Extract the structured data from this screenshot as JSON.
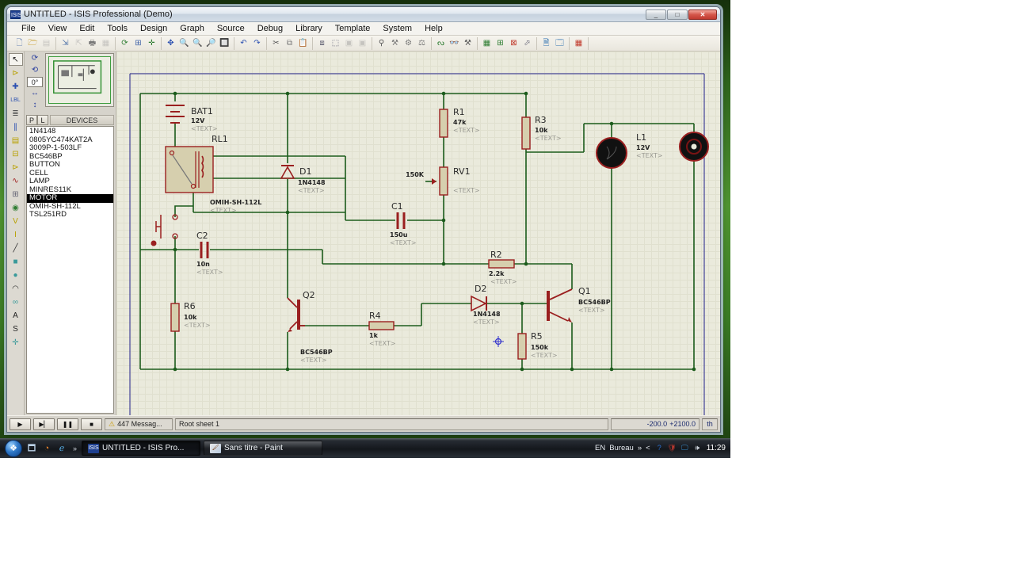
{
  "window": {
    "title": "UNTITLED - ISIS Professional (Demo)",
    "app_icon": "ISIS",
    "controls": {
      "minimize": "_",
      "maximize": "□",
      "close": "✕"
    }
  },
  "menu": {
    "items": [
      "File",
      "View",
      "Edit",
      "Tools",
      "Design",
      "Graph",
      "Source",
      "Debug",
      "Library",
      "Template",
      "System",
      "Help"
    ]
  },
  "toolbar": {
    "groups": [
      [
        {
          "name": "new-file-icon",
          "glyph": "🗋",
          "color": "#6a85b5"
        },
        {
          "name": "open-file-icon",
          "glyph": "🗁",
          "color": "#c9a23a"
        },
        {
          "name": "save-file-icon",
          "glyph": "▤",
          "color": "#888",
          "dim": true
        }
      ],
      [
        {
          "name": "import-icon",
          "glyph": "⇲",
          "color": "#5577aa"
        },
        {
          "name": "export-icon",
          "glyph": "⇱",
          "color": "#888",
          "dim": true
        },
        {
          "name": "print-icon",
          "glyph": "🖶",
          "color": "#777"
        },
        {
          "name": "mark-area-icon",
          "glyph": "▦",
          "color": "#888",
          "dim": true
        }
      ],
      [
        {
          "name": "redraw-icon",
          "glyph": "⟳",
          "color": "#2e7d32"
        },
        {
          "name": "grid-icon",
          "glyph": "⊞",
          "color": "#4466aa"
        },
        {
          "name": "origin-icon",
          "glyph": "✛",
          "color": "#2e7d32"
        }
      ],
      [
        {
          "name": "pan-icon",
          "glyph": "✥",
          "color": "#2a4fb0"
        },
        {
          "name": "zoom-in-icon",
          "glyph": "🔍",
          "color": "#555"
        },
        {
          "name": "zoom-out-icon",
          "glyph": "🔍",
          "color": "#555"
        },
        {
          "name": "zoom-all-icon",
          "glyph": "🔎",
          "color": "#555"
        },
        {
          "name": "zoom-area-icon",
          "glyph": "🔲",
          "color": "#555"
        }
      ],
      [
        {
          "name": "undo-icon",
          "glyph": "↶",
          "color": "#2a4fb0"
        },
        {
          "name": "redo-icon",
          "glyph": "↷",
          "color": "#2a4fb0"
        }
      ],
      [
        {
          "name": "cut-icon",
          "glyph": "✂",
          "color": "#555"
        },
        {
          "name": "copy-icon",
          "glyph": "⧉",
          "color": "#777"
        },
        {
          "name": "paste-icon",
          "glyph": "📋",
          "color": "#777"
        }
      ],
      [
        {
          "name": "block-copy-icon",
          "glyph": "⧈",
          "color": "#667"
        },
        {
          "name": "block-move-icon",
          "glyph": "⬚",
          "color": "#667"
        },
        {
          "name": "block-rotate-icon",
          "glyph": "▣",
          "color": "#888",
          "dim": true
        },
        {
          "name": "block-delete-icon",
          "glyph": "▣",
          "color": "#888",
          "dim": true
        }
      ],
      [
        {
          "name": "pick-device-icon",
          "glyph": "⚲",
          "color": "#555"
        },
        {
          "name": "make-device-icon",
          "glyph": "⚒",
          "color": "#777"
        },
        {
          "name": "packaging-icon",
          "glyph": "⚙",
          "color": "#777"
        },
        {
          "name": "decompose-icon",
          "glyph": "⚖",
          "color": "#777"
        }
      ],
      [
        {
          "name": "wire-autorouter-icon",
          "glyph": "ᔓ",
          "color": "#2e7d32"
        },
        {
          "name": "search-tag-icon",
          "glyph": "👓",
          "color": "#555"
        },
        {
          "name": "property-assign-icon",
          "glyph": "⚒",
          "color": "#555"
        }
      ],
      [
        {
          "name": "design-explorer-icon",
          "glyph": "▦",
          "color": "#2e7d32"
        },
        {
          "name": "new-sheet-icon",
          "glyph": "⊞",
          "color": "#2e7d32"
        },
        {
          "name": "remove-sheet-icon",
          "glyph": "⊠",
          "color": "#c0392b"
        },
        {
          "name": "goto-sheet-icon",
          "glyph": "⬀",
          "color": "#667"
        }
      ],
      [
        {
          "name": "bom-icon",
          "glyph": "🗎",
          "color": "#2a6fb0"
        },
        {
          "name": "erc-icon",
          "glyph": "🗔",
          "color": "#2a6fb0"
        }
      ],
      [
        {
          "name": "netlist-ares-icon",
          "glyph": "▦",
          "color": "#c0392b"
        }
      ]
    ]
  },
  "tools": {
    "items": [
      {
        "name": "selection-tool",
        "glyph": "↖",
        "color": "#111",
        "active": true
      },
      {
        "name": "component-tool",
        "glyph": "⊳",
        "color": "#b8a000"
      },
      {
        "name": "junction-dot-tool",
        "glyph": "✚",
        "color": "#2a4fb0"
      },
      {
        "name": "wire-label-tool",
        "glyph": "LBL",
        "color": "#2a4fb0"
      },
      {
        "name": "text-script-tool",
        "glyph": "≣",
        "color": "#555"
      },
      {
        "name": "bus-tool",
        "glyph": "∥",
        "color": "#2a4fb0"
      },
      {
        "name": "subcircuit-tool",
        "glyph": "▤",
        "color": "#b8a000"
      },
      {
        "name": "terminal-tool",
        "glyph": "⊟",
        "color": "#b8a000"
      },
      {
        "name": "device-pin-tool",
        "glyph": "⊳",
        "color": "#b8a000"
      },
      {
        "name": "graph-tool",
        "glyph": "∿",
        "color": "#a02020"
      },
      {
        "name": "tape-recorder-tool",
        "glyph": "⊞",
        "color": "#667"
      },
      {
        "name": "generator-tool",
        "glyph": "◉",
        "color": "#2e7d32"
      },
      {
        "name": "voltage-probe-tool",
        "glyph": "V",
        "color": "#b8a000"
      },
      {
        "name": "current-probe-tool",
        "glyph": "I",
        "color": "#b8a000"
      },
      {
        "name": "2d-line-tool",
        "glyph": "╱",
        "color": "#333"
      },
      {
        "name": "2d-box-tool",
        "glyph": "■",
        "color": "#3a9a9a"
      },
      {
        "name": "2d-circle-tool",
        "glyph": "●",
        "color": "#3a9a9a"
      },
      {
        "name": "2d-arc-tool",
        "glyph": "◠",
        "color": "#333"
      },
      {
        "name": "2d-path-tool",
        "glyph": "∞",
        "color": "#3a9a9a"
      },
      {
        "name": "2d-text-tool",
        "glyph": "A",
        "color": "#222"
      },
      {
        "name": "2d-symbol-tool",
        "glyph": "S",
        "color": "#222"
      },
      {
        "name": "2d-marker-tool",
        "glyph": "✛",
        "color": "#3a9a9a"
      }
    ]
  },
  "panel": {
    "rotation_value": "0°",
    "rotate_cw": "⟳",
    "rotate_ccw": "⟲",
    "mirror_h": "↔",
    "mirror_v": "↕",
    "p_button": "P",
    "l_button": "L",
    "header": "DEVICES",
    "devices": [
      "1N4148",
      "0805YC474KAT2A",
      "3009P-1-503LF",
      "BC546BP",
      "BUTTON",
      "CELL",
      "LAMP",
      "MINRES11K",
      "MOTOR",
      "OMIH-SH-112L",
      "TSL251RD"
    ],
    "selected_device": "MOTOR"
  },
  "schematic": {
    "components": [
      {
        "ref": "BAT1",
        "value": "12V",
        "text": "<TEXT>"
      },
      {
        "ref": "RL1",
        "model": "OMIH-SH-112L",
        "text": "<TEXT>"
      },
      {
        "ref": "D1",
        "value": "1N4148",
        "text": "<TEXT>"
      },
      {
        "ref": "R1",
        "value": "47k",
        "text": "<TEXT>"
      },
      {
        "ref": "R3",
        "value": "10k",
        "text": "<TEXT>"
      },
      {
        "ref": "RV1",
        "value": "150K",
        "text": "<TEXT>"
      },
      {
        "ref": "L1",
        "value": "12V",
        "text": "<TEXT>"
      },
      {
        "ref": "C1",
        "value": "150u",
        "text": "<TEXT>"
      },
      {
        "ref": "C2",
        "value": "10n",
        "text": "<TEXT>"
      },
      {
        "ref": "R2",
        "value": "2.2k",
        "text": "<TEXT>"
      },
      {
        "ref": "R6",
        "value": "10k",
        "text": "<TEXT>"
      },
      {
        "ref": "Q2",
        "value": "BC546BP",
        "text": "<TEXT>"
      },
      {
        "ref": "R4",
        "value": "1k",
        "text": "<TEXT>"
      },
      {
        "ref": "D2",
        "value": "1N4148",
        "text": "<TEXT>"
      },
      {
        "ref": "Q1",
        "value": "BC546BP",
        "text": "<TEXT>"
      },
      {
        "ref": "R5",
        "value": "150k",
        "text": "<TEXT>"
      }
    ],
    "wire_color": "#1c5c1c",
    "component_color": "#9a1f1f",
    "component_fill": "#d6cfae",
    "sheet_border_color": "#20208a"
  },
  "status_bar": {
    "play": "▶",
    "step": "▶▏",
    "pause": "❚❚",
    "stop": "■",
    "warning_icon": "⚠",
    "message": "447 Messag...",
    "sheet": "Root sheet 1",
    "coord_x": "-200.0",
    "coord_y": "+2100.0",
    "units": "th"
  },
  "taskbar": {
    "quick_launch": [
      {
        "name": "show-desktop-icon",
        "glyph": "🗖",
        "color": "#bcd2e8"
      },
      {
        "name": "browser-orange-icon",
        "glyph": "◔",
        "color": "#e8832a"
      },
      {
        "name": "internet-explorer-icon",
        "glyph": "ℯ",
        "color": "#57b0e8"
      }
    ],
    "chevron": "»",
    "tasks": [
      {
        "label": "UNTITLED - ISIS Pro...",
        "icon": "ISIS",
        "active": true
      },
      {
        "label": "Sans titre - Paint",
        "icon": "🖌",
        "active": false
      }
    ],
    "tray": {
      "language": "EN",
      "desk_label": "Bureau",
      "chevron": "»",
      "arrow": "<",
      "icons": [
        {
          "name": "tray-help-icon",
          "glyph": "?",
          "color": "#2a6fd0"
        },
        {
          "name": "tray-security-icon",
          "glyph": "🛡",
          "color": "#c03a30"
        },
        {
          "name": "tray-network-icon",
          "glyph": "🖵",
          "color": "#3a8fd0"
        },
        {
          "name": "tray-volume-icon",
          "glyph": "🕪",
          "color": "#cfd6de"
        }
      ],
      "time": "11:29"
    }
  }
}
